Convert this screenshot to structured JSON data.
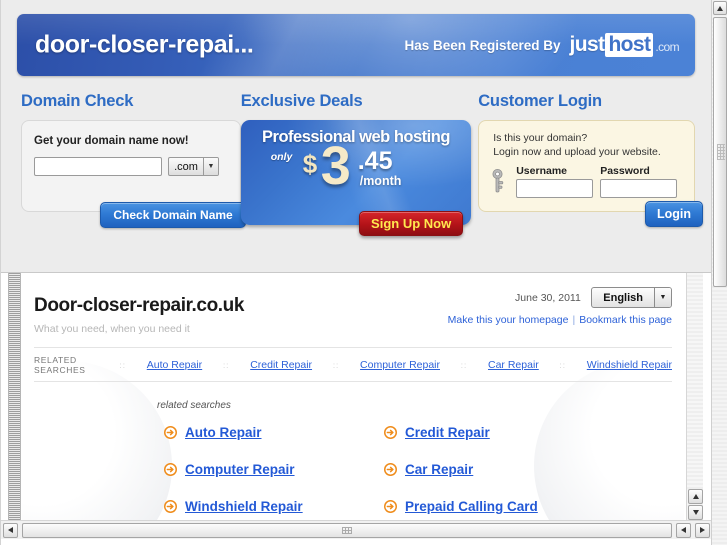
{
  "banner": {
    "domain": "door-closer-repai...",
    "registered_by_text": "Has Been Registered By",
    "logo_just": "just",
    "logo_host": "host",
    "logo_com": ".com",
    "bg_color_left": "#2c4fa8",
    "bg_color_right": "#4b82d6"
  },
  "domain_check": {
    "title": "Domain Check",
    "prompt": "Get your domain name now!",
    "input_value": "",
    "input_placeholder": "",
    "tld_selected": ".com",
    "button_label": "Check Domain Name"
  },
  "deals": {
    "title": "Exclusive Deals",
    "headline": "Professional web hosting",
    "only_label": "only",
    "currency": "$",
    "price_whole": "3",
    "price_cents": ".45",
    "period": "/month",
    "cta_label": "Sign Up Now",
    "cta_bg_color": "#b31318",
    "cta_text_color": "#ffe94f"
  },
  "login": {
    "title": "Customer Login",
    "note_line1": "Is this your domain?",
    "note_line2": "Login now and upload your website.",
    "username_label": "Username",
    "username_value": "",
    "password_label": "Password",
    "password_value": "",
    "button_label": "Login"
  },
  "parked_page": {
    "domain": "Door-closer-repair.co.uk",
    "tagline": "What you need, when you need it",
    "date": "June 30, 2011",
    "language_selected": "English",
    "link_homepage": "Make this your homepage",
    "link_bookmark": "Bookmark this page",
    "separator": "|",
    "related_searches_label": "RELATED SEARCHES",
    "dots": "::",
    "top_links": [
      "Auto Repair",
      "Credit Repair",
      "Computer Repair",
      "Car Repair",
      "Windshield Repair"
    ],
    "sub_heading": "related searches",
    "grid_links": [
      "Auto Repair",
      "Credit Repair",
      "Computer Repair",
      "Car Repair",
      "Windshield Repair",
      "Prepaid Calling Card"
    ],
    "link_color": "#2359d6",
    "arrow_icon_color": "#ef8c1b"
  }
}
